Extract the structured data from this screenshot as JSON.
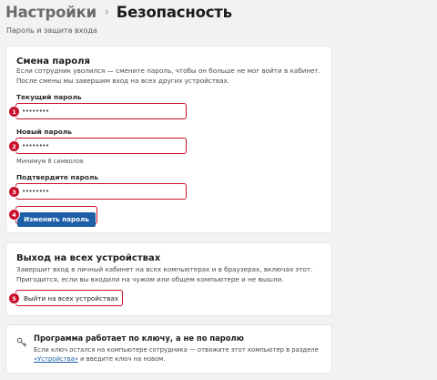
{
  "breadcrumb": {
    "root": "Настройки",
    "separator": "›",
    "current": "Безопасность"
  },
  "subtitle": "Пароль и защита входа",
  "password_section": {
    "title": "Смена пароля",
    "description": "Если сотрудник уволился — смените пароль, чтобы он больше не мог войти в кабинет. После смены мы завершим вход на всех других устройствах.",
    "current_label": "Текущий пароль",
    "current_value": "••••••••",
    "new_label": "Новый пароль",
    "new_value": "••••••••",
    "new_hint": "Минимум 8 символов",
    "confirm_label": "Подтвердите пароль",
    "confirm_value": "••••••••",
    "submit_label": "Изменить пароль"
  },
  "logout_section": {
    "title": "Выход на всех устройствах",
    "description": "Завершит вход в личный кабинет на всех компьютерах и в браузерах, включая этот. Пригодится, если вы входили на чужом или общем компьютере и не вышли.",
    "button_label": "Выйти на всех устройствах"
  },
  "info_section": {
    "icon": "key-icon",
    "title": "Программа работает по ключу, а не по паролю",
    "desc_before": "Если ключ остался на компьютере сотрудника — отвяжите этот компьютер в разделе ",
    "link_text": "«Устройства»",
    "desc_after": " и введите ключ на новом."
  },
  "steps": [
    "1",
    "2",
    "3",
    "4",
    "5"
  ],
  "colors": {
    "accent_red": "#c8102e",
    "primary_blue": "#1f5fa8",
    "background": "#f2f2f3"
  }
}
